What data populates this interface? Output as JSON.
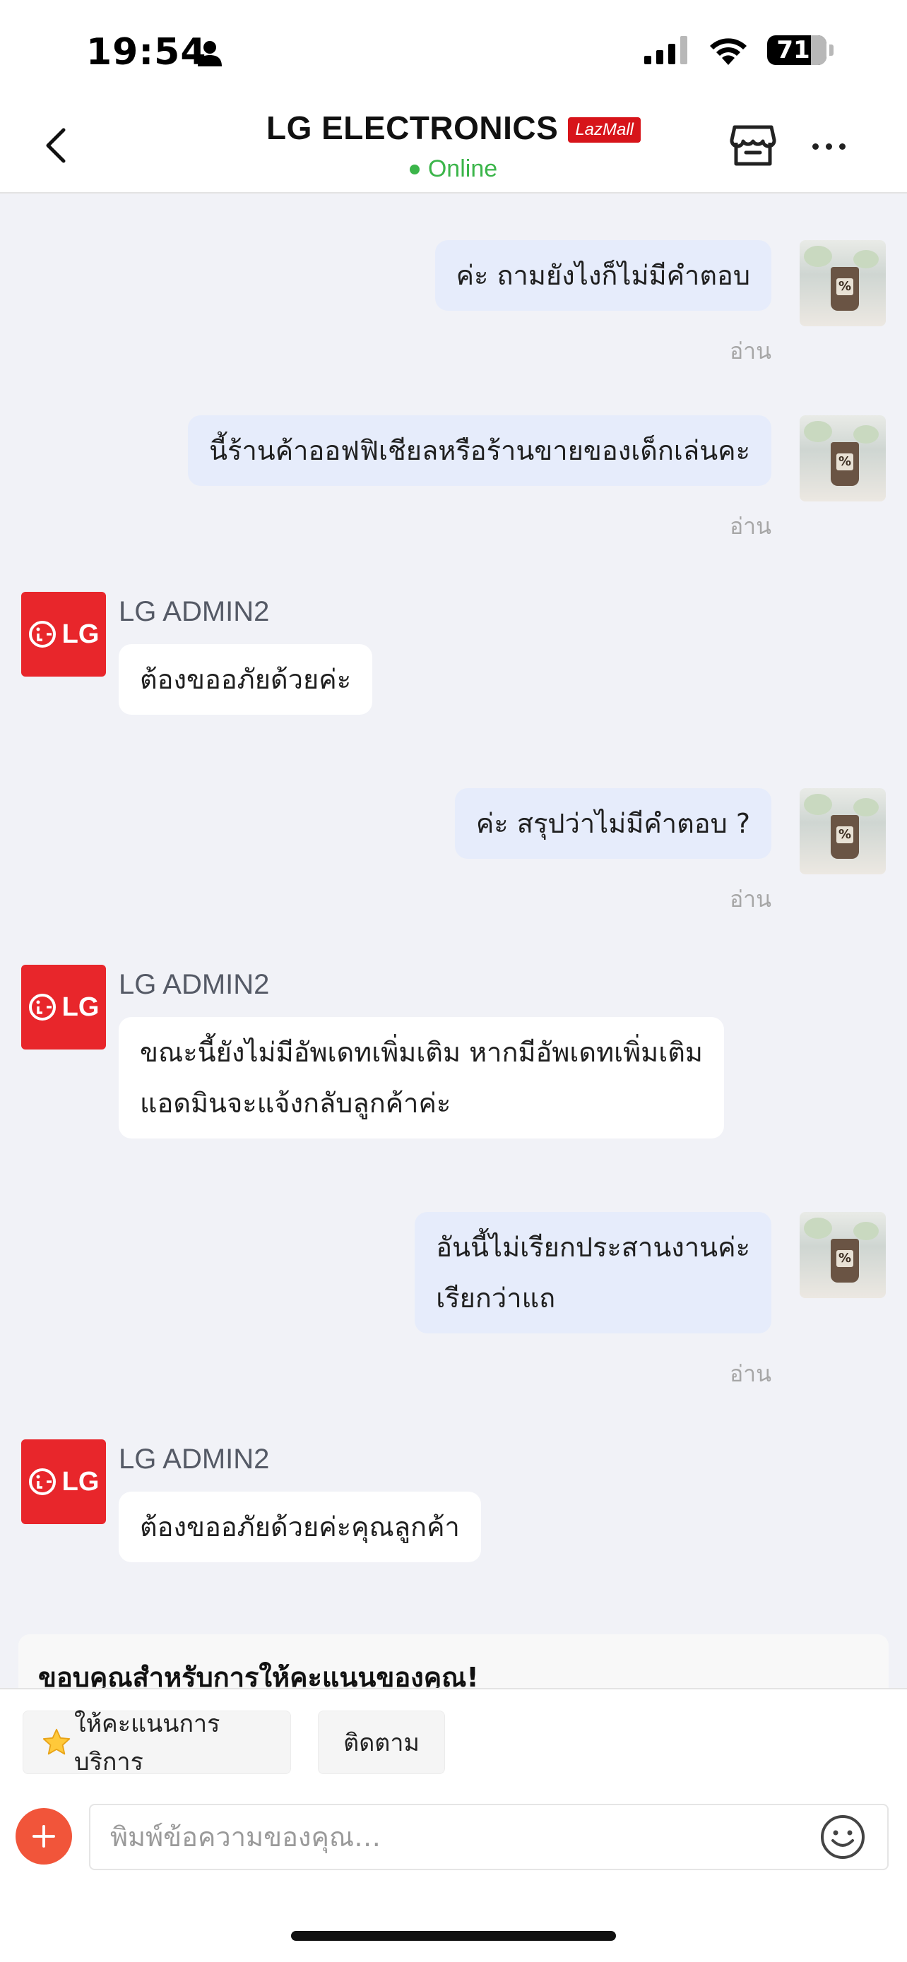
{
  "status_bar": {
    "time": "19:54",
    "battery": "71"
  },
  "header": {
    "shop_name": "LG ELECTRONICS",
    "badge": "LazMall",
    "status": "Online"
  },
  "messages": [
    {
      "side": "out",
      "text": "ค่ะ ถามยังไงก็ไม่มีคำตอบ",
      "read": "อ่าน"
    },
    {
      "side": "out",
      "text": "นี้ร้านค้าออฟฟิเชียลหรือร้านขายของเด็กเล่นคะ",
      "read": "อ่าน"
    },
    {
      "side": "in",
      "sender": "LG ADMIN2",
      "text": "ต้องขออภัยด้วยค่ะ"
    },
    {
      "side": "out",
      "text": "ค่ะ สรุปว่าไม่มีคำตอบ ?",
      "read": "อ่าน"
    },
    {
      "side": "in",
      "sender": "LG ADMIN2",
      "lines": [
        "ขณะนี้ยังไม่มีอัพเดทเพิ่มเติม หากมีอัพเดทเพิ่มเติม",
        "แอดมินจะแจ้งกลับลูกค้าค่ะ"
      ]
    },
    {
      "side": "out",
      "lines": [
        "อันนี้ไม่เรียกประสานงานค่ะ",
        "เรียกว่าแถ"
      ],
      "read": "อ่าน"
    },
    {
      "side": "in",
      "sender": "LG ADMIN2",
      "text": "ต้องขออภัยด้วยค่ะคุณลูกค้า"
    }
  ],
  "lg_logo_text": "LG",
  "rating_card": {
    "title": "ขอบคุณสำหรับการให้คะแนนของคุณ!"
  },
  "quick_actions": {
    "rate": "ให้คะแนนการบริการ",
    "rate_icon": "star-icon",
    "follow": "ติดตาม"
  },
  "composer": {
    "placeholder": "พิมพ์ข้อความของคุณ…",
    "value": ""
  },
  "colors": {
    "online": "#3bb54a",
    "lg_red": "#e8262b",
    "out_bubble": "#e6ecfb",
    "lazmall": "#d7141a",
    "add_button": "#f1553a"
  }
}
